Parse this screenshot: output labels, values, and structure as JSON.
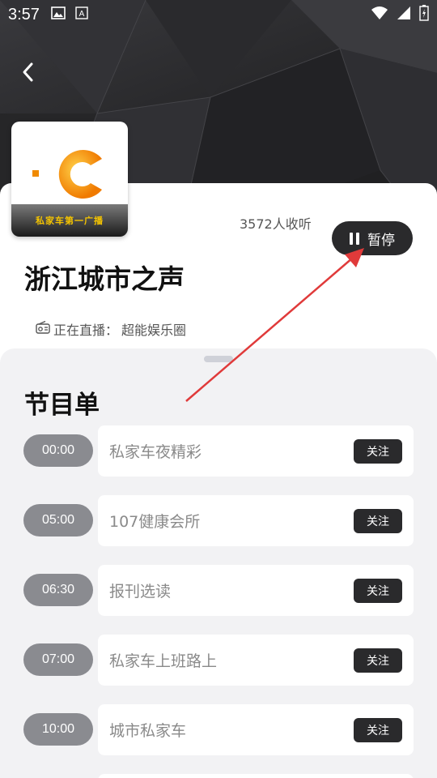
{
  "status_bar": {
    "time": "3:57",
    "icons": [
      "image-icon",
      "a-icon",
      "wifi-icon",
      "signal-icon",
      "battery-icon"
    ]
  },
  "header": {
    "back_icon": "chevron-left-icon"
  },
  "station": {
    "cover_caption": "私家车第一广播",
    "listeners": "3572人收听",
    "title": "浙江城市之声",
    "now_playing_label": "正在直播：",
    "now_playing_program": "超能娱乐圈",
    "pause_label": "暂停"
  },
  "program_list": {
    "title": "节目单",
    "follow_label": "关注",
    "items": [
      {
        "time": "00:00",
        "name": "私家车夜精彩"
      },
      {
        "time": "05:00",
        "name": "107健康会所"
      },
      {
        "time": "06:30",
        "name": "报刊选读"
      },
      {
        "time": "07:00",
        "name": "私家车上班路上"
      },
      {
        "time": "10:00",
        "name": "城市私家车"
      }
    ]
  },
  "colors": {
    "annotation_arrow": "#e03a3a",
    "logo_orange": "#f08a00"
  }
}
